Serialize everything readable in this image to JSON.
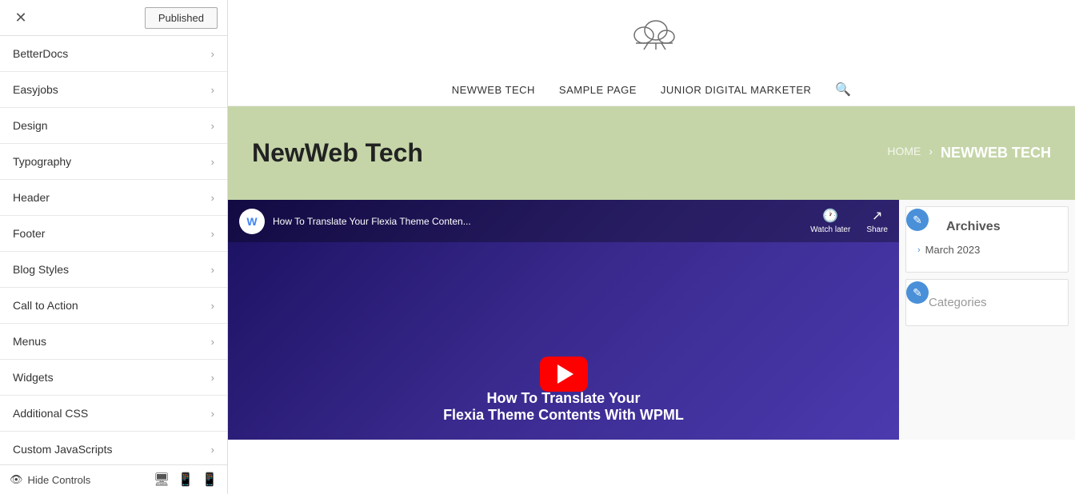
{
  "sidebar": {
    "close_label": "✕",
    "published_label": "Published",
    "items": [
      {
        "id": "betterdocs",
        "label": "BetterDocs"
      },
      {
        "id": "easyjobs",
        "label": "Easyjobs"
      },
      {
        "id": "design",
        "label": "Design"
      },
      {
        "id": "typography",
        "label": "Typography"
      },
      {
        "id": "header",
        "label": "Header"
      },
      {
        "id": "footer",
        "label": "Footer"
      },
      {
        "id": "blog-styles",
        "label": "Blog Styles"
      },
      {
        "id": "call-to-action",
        "label": "Call to Action"
      },
      {
        "id": "menus",
        "label": "Menus"
      },
      {
        "id": "widgets",
        "label": "Widgets"
      },
      {
        "id": "additional-css",
        "label": "Additional CSS"
      },
      {
        "id": "custom-js",
        "label": "Custom JavaScripts"
      }
    ],
    "footer": {
      "hide_controls_label": "Hide Controls"
    }
  },
  "site": {
    "logo_alt": "Site Logo",
    "nav": {
      "links": [
        {
          "id": "newweb-tech",
          "label": "NEWWEB TECH"
        },
        {
          "id": "sample-page",
          "label": "SAMPLE PAGE"
        },
        {
          "id": "junior-digital-marketer",
          "label": "JUNIOR DIGITAL MARKETER"
        }
      ],
      "search_icon": "🔍"
    },
    "hero": {
      "title": "NewWeb Tech",
      "breadcrumb_home": "HOME",
      "breadcrumb_current": "NEWWEB TECH"
    },
    "video": {
      "channel_initial": "W",
      "title": "How To Translate Your Flexia Theme Conten...",
      "watch_later": "Watch later",
      "share": "Share",
      "caption_line1": "How To Translate Your",
      "caption_line2": "Flexia Theme Contents With WPML"
    },
    "widgets": {
      "archives": {
        "edit_icon": "✎",
        "title": "Archives",
        "items": [
          {
            "label": "March 2023"
          }
        ]
      },
      "categories": {
        "edit_icon": "✎",
        "title": "Categories"
      }
    }
  }
}
